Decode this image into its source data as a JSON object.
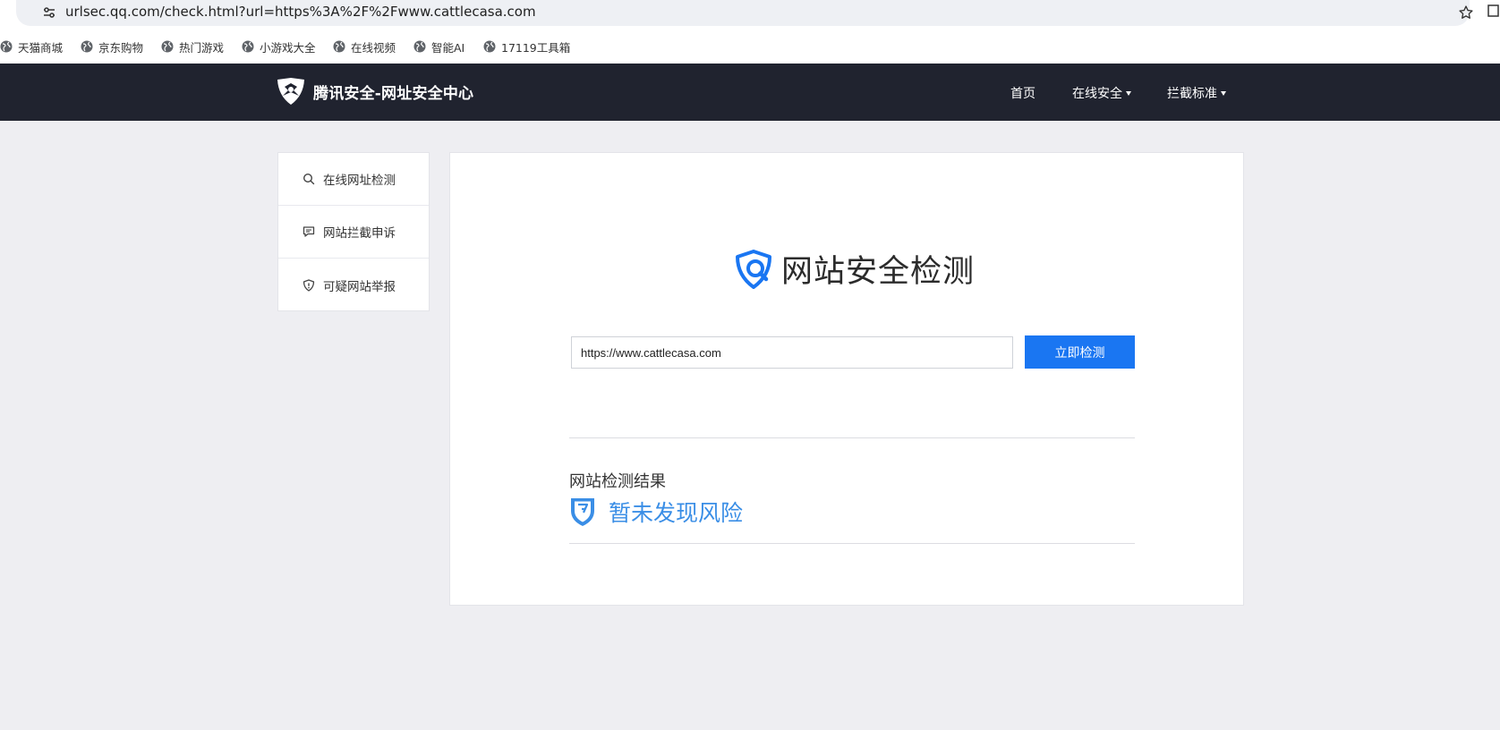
{
  "browser": {
    "url": "urlsec.qq.com/check.html?url=https%3A%2F%2Fwww.cattlecasa.com",
    "bookmarks": [
      {
        "label": "天猫商城",
        "icon": "globe-icon"
      },
      {
        "label": "京东购物",
        "icon": "globe-icon"
      },
      {
        "label": "热门游戏",
        "icon": "globe-icon"
      },
      {
        "label": "小游戏大全",
        "icon": "globe-icon"
      },
      {
        "label": "在线视频",
        "icon": "globe-icon"
      },
      {
        "label": "智能AI",
        "icon": "globe-icon"
      },
      {
        "label": "17119工具箱",
        "icon": "globe-icon"
      }
    ]
  },
  "header": {
    "logo_text": "腾讯安全-网址安全中心",
    "nav": [
      {
        "label": "首页",
        "dropdown": false
      },
      {
        "label": "在线安全",
        "dropdown": true
      },
      {
        "label": "拦截标准",
        "dropdown": true
      }
    ]
  },
  "sidebar": {
    "items": [
      {
        "label": "在线网址检测",
        "icon": "search-icon"
      },
      {
        "label": "网站拦截申诉",
        "icon": "chat-icon"
      },
      {
        "label": "可疑网站举报",
        "icon": "shield-alert-icon"
      }
    ]
  },
  "main": {
    "title": "网站安全检测",
    "input_value": "https://www.cattlecasa.com",
    "check_button": "立即检测",
    "result_label": "网站检测结果",
    "result_text": "暂未发现风险"
  },
  "colors": {
    "header_bg": "#20232f",
    "accent_blue": "#1a76f2",
    "result_blue": "#3a8ee6",
    "page_bg": "#eeeef2"
  }
}
